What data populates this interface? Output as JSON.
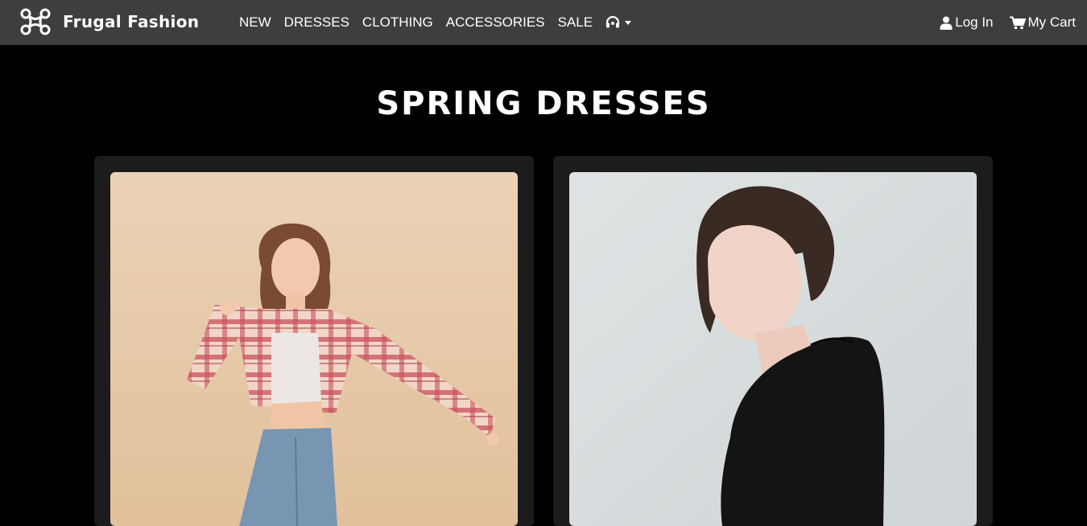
{
  "brand": {
    "name": "Frugal Fashion",
    "logo_icon": "drone-icon"
  },
  "nav": {
    "links": [
      "NEW",
      "DRESSES",
      "CLOTHING",
      "ACCESSORIES",
      "SALE"
    ],
    "support_icon": "headset-icon",
    "login_label": "Log In",
    "cart_label": "My Cart"
  },
  "page": {
    "title": "SPRING DRESSES"
  },
  "products": [
    {
      "image_icon": "model-plaid-shirt-photo"
    },
    {
      "image_icon": "model-black-top-photo"
    }
  ],
  "colors": {
    "navbar": "#3f3e3f",
    "background": "#000000",
    "card": "#1c1c1c"
  }
}
